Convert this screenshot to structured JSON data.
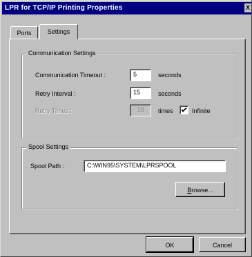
{
  "window": {
    "title": "LPR for TCP/IP Printing Properties",
    "close_glyph": "X"
  },
  "tabs": [
    {
      "label": "Ports",
      "selected": false
    },
    {
      "label": "Settings",
      "selected": true
    }
  ],
  "communication": {
    "group_title": "Communication Settings",
    "timeout_label": "Communication Timeout :",
    "timeout_value": "5",
    "timeout_unit": "seconds",
    "retry_interval_label": "Retry Interval :",
    "retry_interval_value": "15",
    "retry_interval_unit": "seconds",
    "retry_times_label": "Retry Times :",
    "retry_times_value": "10",
    "retry_times_unit": "times",
    "infinite_label": "Infinite",
    "infinite_checked": true
  },
  "spool": {
    "group_title": "Spool Settings",
    "path_label": "Spool Path :",
    "path_value": "C:\\WIN95\\SYSTEM\\LPRSPOOL",
    "browse_label": "Browse..."
  },
  "buttons": {
    "ok_label": "OK",
    "cancel_label": "Cancel"
  },
  "icons": {
    "close": "close-icon",
    "checkmark": "checkmark-icon"
  }
}
